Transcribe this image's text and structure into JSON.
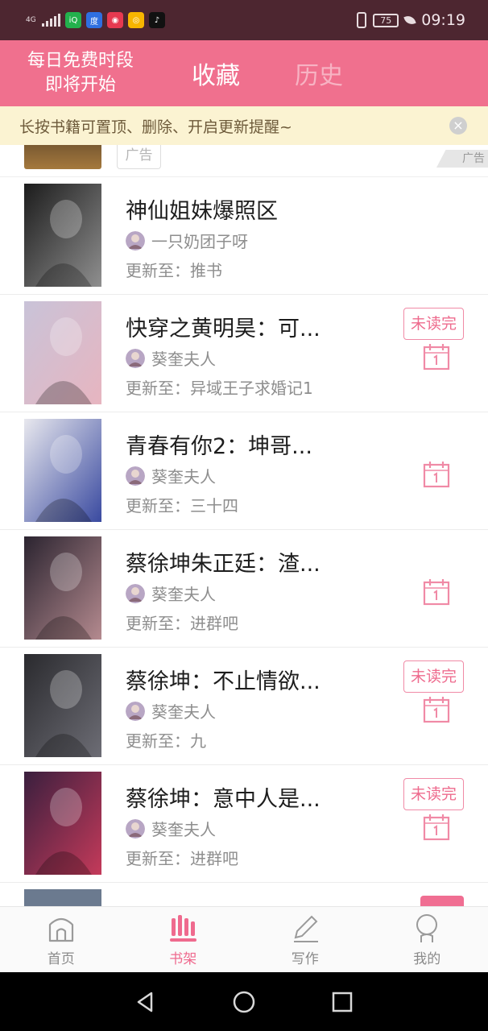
{
  "status_bar": {
    "network": "4G",
    "battery": "75",
    "time": "09:19",
    "apps": [
      {
        "name": "iqiyi-icon",
        "color": "#23b14d",
        "glyph": "iQ"
      },
      {
        "name": "baidu-icon",
        "color": "#2f6fe0",
        "glyph": "度"
      },
      {
        "name": "app-red-icon",
        "color": "#e63950",
        "glyph": "◉"
      },
      {
        "name": "weibo-icon",
        "color": "#f7b500",
        "glyph": "◎"
      },
      {
        "name": "tiktok-icon",
        "color": "#111111",
        "glyph": "♪"
      }
    ]
  },
  "header": {
    "free_line1": "每日免费时段",
    "free_line2": "即将开始",
    "tab_favorites": "收藏",
    "tab_history": "历史",
    "accent": "#f0708e"
  },
  "tip": {
    "text": "长按书籍可置顶、删除、开启更新提醒~",
    "close": "×"
  },
  "ad": {
    "tag": "广告",
    "corner": "广告"
  },
  "books": [
    {
      "title": "神仙姐妹爆照区",
      "author": "一只奶团子呀",
      "update": "更新至：推书",
      "unread": "",
      "calendar": false,
      "cover_colors": [
        "#1c1c1c",
        "#8f8f8f"
      ]
    },
    {
      "title": "快穿之黄明昊：可...",
      "author": "葵奎夫人",
      "update": "更新至：异域王子求婚记1",
      "unread": "未读完",
      "calendar": true,
      "cover_colors": [
        "#c9c3d8",
        "#e7b5c0"
      ]
    },
    {
      "title": "青春有你2：坤哥...",
      "author": "葵奎夫人",
      "update": "更新至：三十四",
      "unread": "",
      "calendar": true,
      "cover_colors": [
        "#e8e8ee",
        "#3a4aa0"
      ]
    },
    {
      "title": "蔡徐坤朱正廷：渣...",
      "author": "葵奎夫人",
      "update": "更新至：进群吧",
      "unread": "",
      "calendar": true,
      "cover_colors": [
        "#2b2430",
        "#b48a8f"
      ]
    },
    {
      "title": "蔡徐坤：不止情欲...",
      "author": "葵奎夫人",
      "update": "更新至：九",
      "unread": "未读完",
      "calendar": true,
      "cover_colors": [
        "#2a2a2e",
        "#6d6d75"
      ]
    },
    {
      "title": "蔡徐坤：意中人是...",
      "author": "葵奎夫人",
      "update": "更新至：进群吧",
      "unread": "未读完",
      "calendar": true,
      "cover_colors": [
        "#3a1f3e",
        "#c43a5a"
      ]
    }
  ],
  "bottom_nav": [
    {
      "label": "首页",
      "icon": "home-icon",
      "active": false
    },
    {
      "label": "书架",
      "icon": "bookshelf-icon",
      "active": true
    },
    {
      "label": "写作",
      "icon": "pencil-icon",
      "active": false
    },
    {
      "label": "我的",
      "icon": "profile-icon",
      "active": false
    }
  ]
}
